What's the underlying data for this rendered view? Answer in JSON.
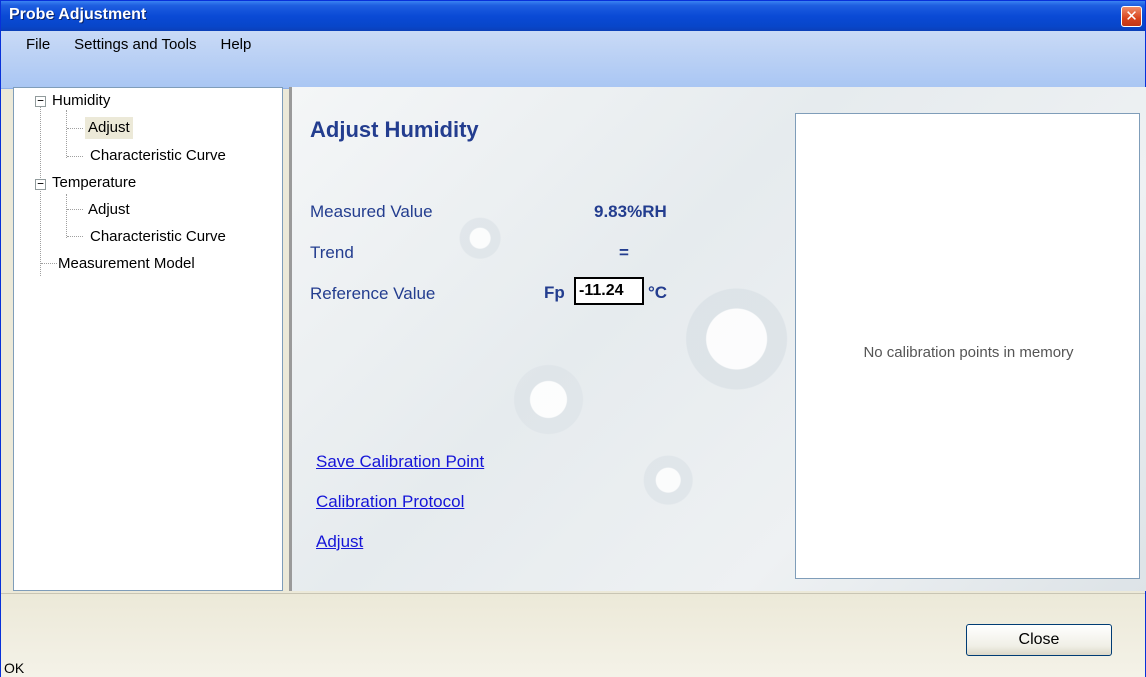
{
  "window": {
    "title": "Probe Adjustment",
    "close_glyph": "✕"
  },
  "menu": [
    "File",
    "Settings and Tools",
    "Help"
  ],
  "tree": {
    "humidity": {
      "label": "Humidity",
      "adjust": "Adjust",
      "curve": "Characteristic Curve"
    },
    "temperature": {
      "label": "Temperature",
      "adjust": "Adjust",
      "curve": "Characteristic Curve"
    },
    "measurement_model": "Measurement Model",
    "expander_glyph": "−"
  },
  "panel": {
    "heading": "Adjust Humidity",
    "measured_label": "Measured Value",
    "measured_value": "9.83%RH",
    "trend_label": "Trend",
    "trend_value": "=",
    "reference_label": "Reference Value",
    "reference_prefix": "Fp",
    "reference_value": "-11.24",
    "reference_unit": "°C",
    "links": [
      "Save Calibration Point",
      "Calibration Protocol",
      "Adjust"
    ],
    "calibration_message": "No calibration points in memory"
  },
  "footer": {
    "status": "OK",
    "close_label": "Close"
  },
  "colors": {
    "heading": "#233d8f",
    "link": "#1515d8",
    "titlebar": "#0a4ad6"
  }
}
